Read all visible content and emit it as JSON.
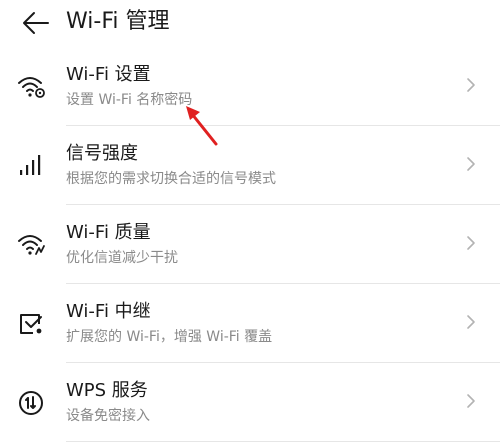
{
  "header": {
    "title": "Wi-Fi 管理"
  },
  "items": [
    {
      "title": "Wi-Fi 设置",
      "subtitle": "设置 Wi-Fi 名称密码",
      "icon": "wifi-settings-icon"
    },
    {
      "title": "信号强度",
      "subtitle": "根据您的需求切换合适的信号模式",
      "icon": "signal-strength-icon"
    },
    {
      "title": "Wi-Fi 质量",
      "subtitle": "优化信道减少干扰",
      "icon": "wifi-quality-icon"
    },
    {
      "title": "Wi-Fi 中继",
      "subtitle": "扩展您的 Wi-Fi，增强 Wi-Fi 覆盖",
      "icon": "wifi-relay-icon"
    },
    {
      "title": "WPS 服务",
      "subtitle": "设备免密接入",
      "icon": "wps-icon"
    }
  ],
  "colors": {
    "text_primary": "#1a1a1a",
    "text_secondary": "#8a8a8a",
    "divider": "#e6e6e6",
    "annotation_arrow": "#e02020"
  }
}
